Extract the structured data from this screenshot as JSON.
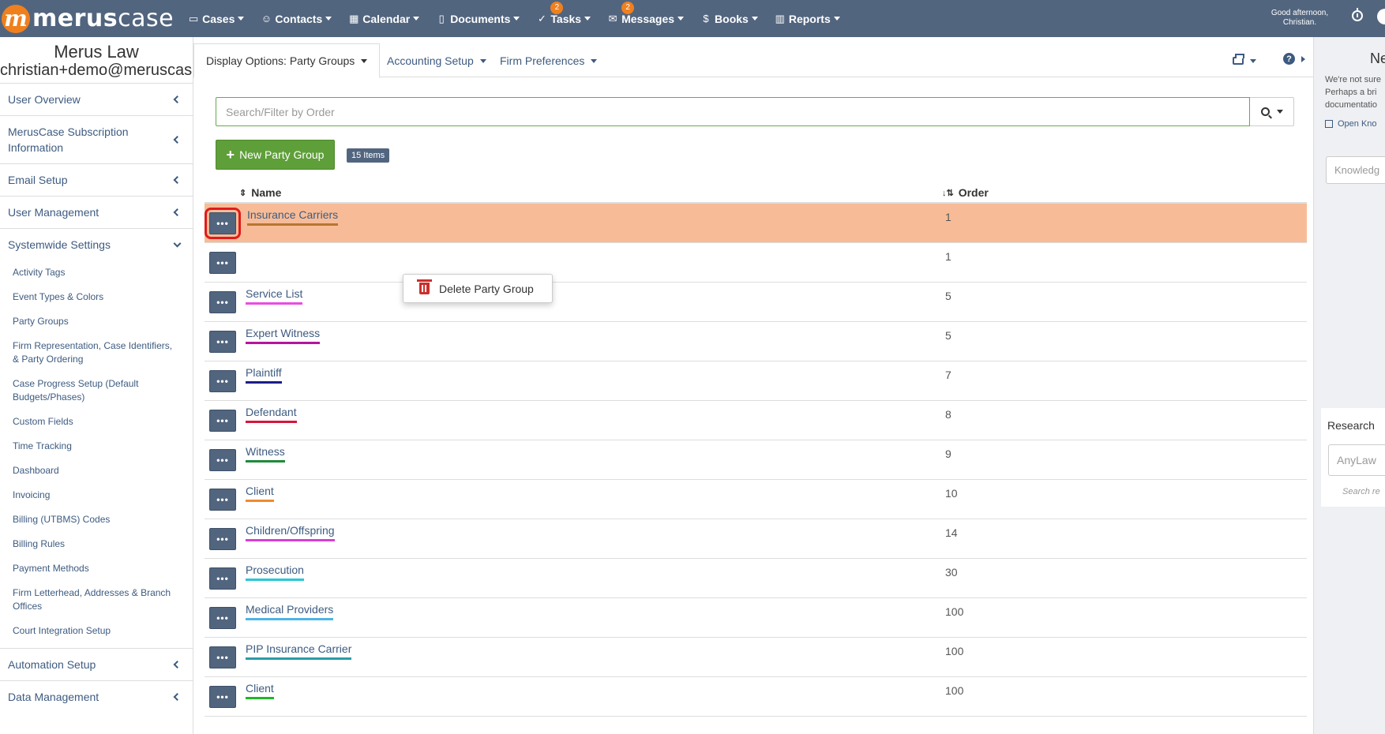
{
  "brand": {
    "logo_mark": "m",
    "logo_text_bold": "merus",
    "logo_text_light": "case"
  },
  "nav": [
    {
      "label": "Cases",
      "icon": "folder-icon",
      "glyph": "▭"
    },
    {
      "label": "Contacts",
      "icon": "users-icon",
      "glyph": "☺"
    },
    {
      "label": "Calendar",
      "icon": "calendar-icon",
      "glyph": "▦"
    },
    {
      "label": "Documents",
      "icon": "document-icon",
      "glyph": "▯"
    },
    {
      "label": "Tasks",
      "icon": "check-circle-icon",
      "glyph": "✓",
      "badge": "2"
    },
    {
      "label": "Messages",
      "icon": "envelope-icon",
      "glyph": "✉",
      "badge": "2"
    },
    {
      "label": "Books",
      "icon": "dollar-circle-icon",
      "glyph": "$"
    },
    {
      "label": "Reports",
      "icon": "bar-chart-icon",
      "glyph": "▥"
    }
  ],
  "greeting": {
    "line1": "Good afternoon,",
    "line2": "Christian."
  },
  "sidebar": {
    "firm_name": "Merus Law",
    "user_email": "christian+demo@meruscase",
    "sections": [
      {
        "label": "User Overview"
      },
      {
        "label": "MerusCase Subscription Information"
      },
      {
        "label": "Email Setup"
      },
      {
        "label": "User Management"
      },
      {
        "label": "Systemwide Settings"
      }
    ],
    "sub_items": [
      "Activity Tags",
      "Event Types & Colors",
      "Party Groups",
      "Firm Representation, Case Identifiers, & Party Ordering",
      "Case Progress Setup (Default Budgets/Phases)",
      "Custom Fields",
      "Time Tracking",
      "Dashboard",
      "Invoicing",
      "Billing (UTBMS) Codes",
      "Billing Rules",
      "Payment Methods",
      "Firm Letterhead, Addresses & Branch Offices",
      "Court Integration Setup"
    ],
    "bottom_sections": [
      {
        "label": "Automation Setup"
      },
      {
        "label": "Data Management"
      }
    ]
  },
  "tabs": [
    {
      "label": "Display Options: Party Groups",
      "active": true
    },
    {
      "label": "Accounting Setup",
      "active": false
    },
    {
      "label": "Firm Preferences",
      "active": false
    }
  ],
  "search": {
    "placeholder": "Search/Filter by Order"
  },
  "new_button": {
    "label": "New Party Group"
  },
  "count_badge": "15 Items",
  "table": {
    "headers": {
      "name": "Name",
      "order": "Order"
    },
    "rows": [
      {
        "name": "Insurance Carriers",
        "order": "1",
        "color": "#b8762f"
      },
      {
        "name": "",
        "order": "1",
        "color": "#ffffff"
      },
      {
        "name": "Service List",
        "order": "5",
        "color": "#e94de3"
      },
      {
        "name": "Expert Witness",
        "order": "5",
        "color": "#b5159e"
      },
      {
        "name": "Plaintiff",
        "order": "7",
        "color": "#1c1c8a"
      },
      {
        "name": "Defendant",
        "order": "8",
        "color": "#d6163a"
      },
      {
        "name": "Witness",
        "order": "9",
        "color": "#1e8a3a"
      },
      {
        "name": "Client",
        "order": "10",
        "color": "#f08a2e"
      },
      {
        "name": "Children/Offspring",
        "order": "14",
        "color": "#d63ed6"
      },
      {
        "name": "Prosecution",
        "order": "30",
        "color": "#27c8d6"
      },
      {
        "name": "Medical Providers",
        "order": "100",
        "color": "#4cb4e6"
      },
      {
        "name": "PIP Insurance Carrier",
        "order": "100",
        "color": "#2a9ca8"
      },
      {
        "name": "Client",
        "order": "100",
        "color": "#21b52a"
      }
    ],
    "highlight_color": "#f7bc97"
  },
  "row_menu": {
    "delete_label": "Delete Party Group"
  },
  "right_panel": {
    "title": "Ne",
    "text_lines": [
      "We're not sure",
      "Perhaps a bri",
      "documentatio"
    ],
    "link": "Open Kno",
    "kb_placeholder": "Knowledg",
    "research_title": "Research",
    "research_input": "AnyLaw",
    "research_hint": "Search re"
  },
  "colors": {
    "topbar": "#52657f",
    "accent": "#f0801d",
    "link": "#3d5b80",
    "green": "#5f9f3a"
  }
}
